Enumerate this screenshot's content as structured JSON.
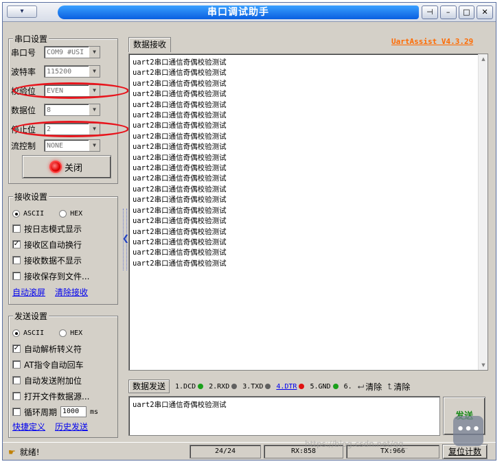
{
  "window": {
    "title": "串口调试助手",
    "sys_menu": "▾",
    "buttons": {
      "pin": "⊣",
      "minimize": "–",
      "maximize": "□",
      "close": "✕"
    }
  },
  "serial_settings": {
    "group_title": "串口设置",
    "fields": [
      {
        "label": "串口号",
        "value": "COM9 #USI"
      },
      {
        "label": "波特率",
        "value": "115200"
      },
      {
        "label": "校验位",
        "value": "EVEN"
      },
      {
        "label": "数据位",
        "value": "8"
      },
      {
        "label": "停止位",
        "value": "2"
      },
      {
        "label": "流控制",
        "value": "NONE"
      }
    ],
    "close_button": "关闭",
    "highlight_color": "#e8141c"
  },
  "receive_settings": {
    "group_title": "接收设置",
    "radio_ascii": "ASCII",
    "radio_hex": "HEX",
    "options": [
      {
        "label": "按日志模式显示",
        "checked": false
      },
      {
        "label": "接收区自动换行",
        "checked": true
      },
      {
        "label": "接收数据不显示",
        "checked": false
      },
      {
        "label": "接收保存到文件...",
        "checked": false
      }
    ],
    "links": [
      "自动滚屏",
      "清除接收"
    ]
  },
  "send_settings": {
    "group_title": "发送设置",
    "radio_ascii": "ASCII",
    "radio_hex": "HEX",
    "options": [
      {
        "label": "自动解析转义符",
        "checked": true
      },
      {
        "label": "AT指令自动回车",
        "checked": false
      },
      {
        "label": "自动发送附加位",
        "checked": false
      },
      {
        "label": "打开文件数据源...",
        "checked": false
      }
    ],
    "cycle": {
      "label": "循环周期",
      "value": "1000",
      "unit": "ms",
      "checked": false
    },
    "links": [
      "快捷定义",
      "历史发送"
    ]
  },
  "receive_area": {
    "tab": "数据接收",
    "version": "UartAssist V4.3.29",
    "lines": [
      "uart2串口通信奇偶校验测试",
      "uart2串口通信奇偶校验测试",
      "uart2串口通信奇偶校验测试",
      "uart2串口通信奇偶校验测试",
      "uart2串口通信奇偶校验测试",
      "uart2串口通信奇偶校验测试",
      "uart2串口通信奇偶校验测试",
      "uart2串口通信奇偶校验测试",
      "uart2串口通信奇偶校验测试",
      "uart2串口通信奇偶校验测试",
      "uart2串口通信奇偶校验测试",
      "uart2串口通信奇偶校验测试",
      "uart2串口通信奇偶校验测试",
      "uart2串口通信奇偶校验测试",
      "uart2串口通信奇偶校验测试",
      "uart2串口通信奇偶校验测试",
      "uart2串口通信奇偶校验测试",
      "uart2串口通信奇偶校验测试",
      "uart2串口通信奇偶校验测试",
      "uart2串口通信奇偶校验测试"
    ]
  },
  "send_area": {
    "tab": "数据发送",
    "signals": [
      {
        "label": "1.DCD",
        "color": "#1aa01a"
      },
      {
        "label": "2.RXD",
        "color": "#606060"
      },
      {
        "label": "3.TXD",
        "color": "#606060"
      },
      {
        "label": "4.DTR",
        "color": "#e01010"
      },
      {
        "label": "5.GND",
        "color": "#1aa01a"
      },
      {
        "label": "6.",
        "color": ""
      }
    ],
    "clear_1": "清除",
    "clear_2": "清除",
    "text": "uart2串口通信奇偶校验测试",
    "send_button": "发送"
  },
  "status_bar": {
    "status": "就绪!",
    "count": "24/24",
    "rx": "RX:858",
    "tx": "TX:966",
    "reset_button": "复位计数"
  },
  "overlay": {
    "watermark": "https://blog.csdn.net/qq_",
    "chat_glyph": "•••"
  }
}
